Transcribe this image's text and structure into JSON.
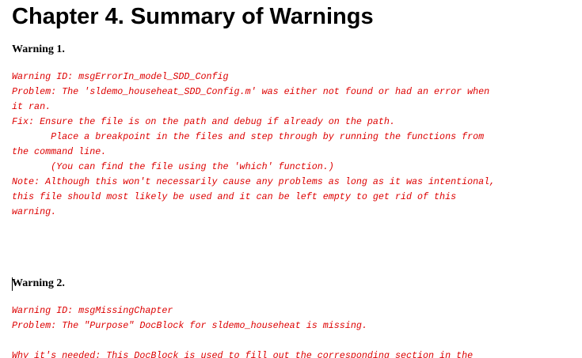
{
  "chapter": {
    "title": "Chapter 4. Summary of Warnings"
  },
  "warnings": [
    {
      "heading": "Warning 1.",
      "lines": [
        "Warning ID: msgErrorIn_model_SDD_Config",
        "Problem: The 'sldemo_househeat_SDD_Config.m' was either not found or had an error when",
        "it ran.",
        "Fix: Ensure the file is on the path and debug if already on the path.",
        "       Place a breakpoint in the files and step through by running the functions from",
        "the command line.",
        "       (You can find the file using the 'which' function.)",
        "Note: Although this won't necessarily cause any problems as long as it was intentional,",
        "this file should most likely be used and it can be left empty to get rid of this",
        "warning."
      ]
    },
    {
      "heading": "Warning 2.",
      "lines": [
        "Warning ID: msgMissingChapter",
        "Problem: The \"Purpose\" DocBlock for sldemo_househeat is missing.",
        "",
        "Why it's needed: This DocBlock is used to fill out the corresponding section in the"
      ]
    }
  ]
}
